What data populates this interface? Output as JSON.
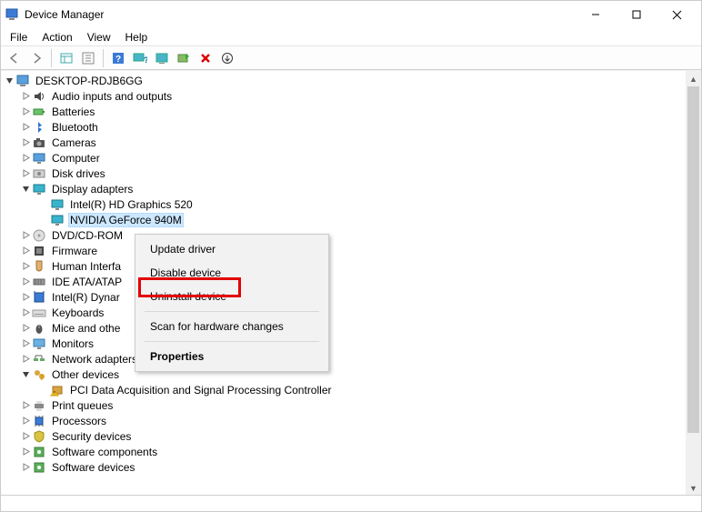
{
  "window": {
    "title": "Device Manager"
  },
  "menu": [
    "File",
    "Action",
    "View",
    "Help"
  ],
  "toolbar_icons": [
    "arrow-left-icon",
    "arrow-right-icon",
    "show-hidden-icon",
    "grid-icon",
    "help-icon",
    "monitor-help-icon",
    "monitor-icon",
    "scan-icon",
    "delete-icon",
    "update-icon"
  ],
  "tree": {
    "root": {
      "label": "DESKTOP-RDJB6GG",
      "icon": "computer-icon",
      "expanded": true,
      "children": [
        {
          "label": "Audio inputs and outputs",
          "icon": "audio-icon"
        },
        {
          "label": "Batteries",
          "icon": "battery-icon"
        },
        {
          "label": "Bluetooth",
          "icon": "bluetooth-icon"
        },
        {
          "label": "Cameras",
          "icon": "camera-icon"
        },
        {
          "label": "Computer",
          "icon": "monitor-icon"
        },
        {
          "label": "Disk drives",
          "icon": "disk-icon"
        },
        {
          "label": "Display adapters",
          "icon": "display-icon",
          "expanded": true,
          "children": [
            {
              "label": "Intel(R) HD Graphics 520",
              "icon": "display-icon"
            },
            {
              "label": "NVIDIA GeForce 940M",
              "icon": "display-icon",
              "selected": true
            }
          ]
        },
        {
          "label": "DVD/CD-ROM",
          "icon": "dvd-icon",
          "truncated": true
        },
        {
          "label": "Firmware",
          "icon": "firmware-icon"
        },
        {
          "label": "Human Interfa",
          "icon": "hid-icon",
          "truncated": true
        },
        {
          "label": "IDE ATA/ATAP",
          "icon": "ide-icon",
          "truncated": true
        },
        {
          "label": "Intel(R) Dynar",
          "icon": "intel-icon",
          "truncated": true
        },
        {
          "label": "Keyboards",
          "icon": "keyboard-icon"
        },
        {
          "label": "Mice and othe",
          "icon": "mouse-icon",
          "truncated": true
        },
        {
          "label": "Monitors",
          "icon": "monitor-dev-icon"
        },
        {
          "label": "Network adapters",
          "icon": "network-icon"
        },
        {
          "label": "Other devices",
          "icon": "other-icon",
          "expanded": true,
          "children": [
            {
              "label": "PCI Data Acquisition and Signal Processing Controller",
              "icon": "warn-icon",
              "leaf": true
            }
          ]
        },
        {
          "label": "Print queues",
          "icon": "print-icon"
        },
        {
          "label": "Processors",
          "icon": "cpu-icon"
        },
        {
          "label": "Security devices",
          "icon": "security-icon"
        },
        {
          "label": "Software components",
          "icon": "software-icon"
        },
        {
          "label": "Software devices",
          "icon": "software-icon",
          "partial": true
        }
      ]
    }
  },
  "context_menu": {
    "items": [
      {
        "label": "Update driver"
      },
      {
        "label": "Disable device"
      },
      {
        "label": "Uninstall device",
        "highlighted": true
      },
      {
        "sep": true
      },
      {
        "label": "Scan for hardware changes"
      },
      {
        "sep": true
      },
      {
        "label": "Properties",
        "bold": true
      }
    ]
  }
}
